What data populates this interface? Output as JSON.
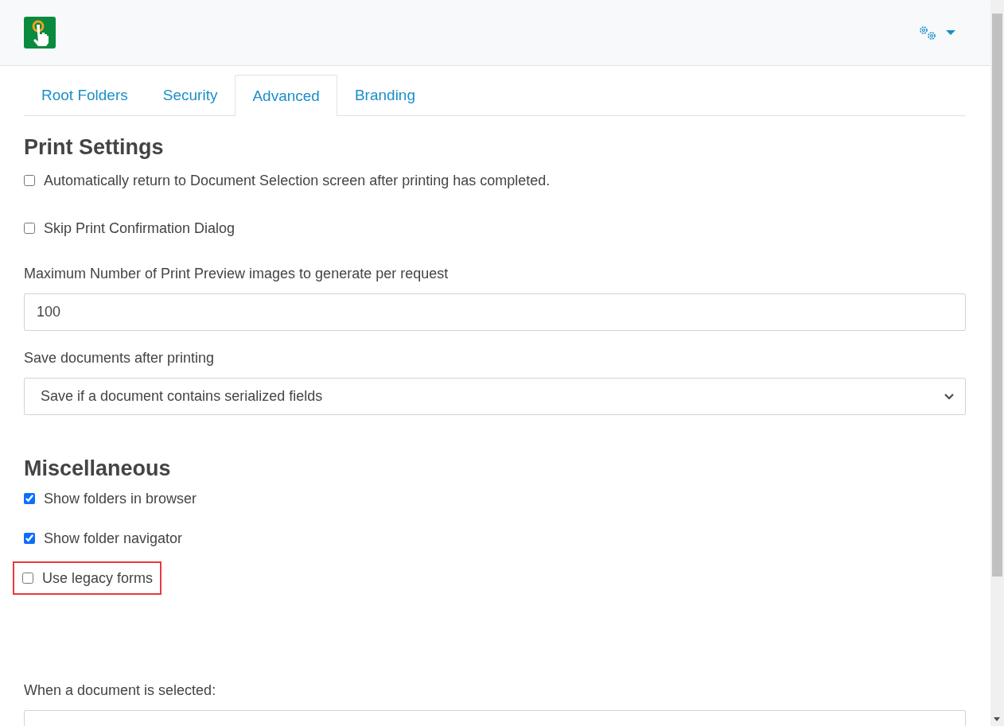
{
  "tabs": [
    {
      "label": "Root Folders",
      "selected": false
    },
    {
      "label": "Security",
      "selected": false
    },
    {
      "label": "Advanced",
      "selected": true
    },
    {
      "label": "Branding",
      "selected": false
    }
  ],
  "print_settings": {
    "heading": "Print Settings",
    "checkboxes": [
      {
        "label": "Automatically return to Document Selection screen after printing has completed.",
        "checked": false
      },
      {
        "label": "Skip Print Confirmation Dialog",
        "checked": false
      }
    ],
    "max_preview": {
      "label": "Maximum Number of Print Preview images to generate per request",
      "value": "100"
    },
    "save_documents": {
      "label": "Save documents after printing",
      "value": "Save if a document contains serialized fields"
    }
  },
  "miscellaneous": {
    "heading": "Miscellaneous",
    "checkboxes": [
      {
        "label": "Show folders in browser",
        "checked": true,
        "highlighted": false
      },
      {
        "label": "Show folder navigator",
        "checked": true,
        "highlighted": false
      },
      {
        "label": "Use legacy forms",
        "checked": false,
        "highlighted": true
      }
    ],
    "document_selected": {
      "label": "When a document is selected:"
    }
  }
}
